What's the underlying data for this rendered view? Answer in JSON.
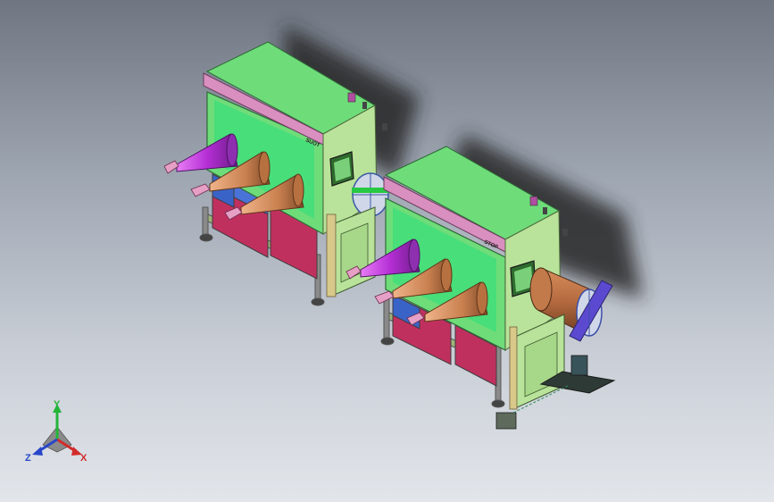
{
  "viewport": {
    "axes": {
      "x_label": "X",
      "y_label": "Y",
      "z_label": "Z"
    }
  },
  "model": {
    "left_unit_plate": "SUOT",
    "right_unit_plate": "STOP"
  },
  "colors": {
    "body_green": "#6fdc7a",
    "side_green": "#b9e39a",
    "top_pink": "#d98fc0",
    "glove_magenta": "#c24be0",
    "glove_copper": "#d8925f",
    "lower_panel_magenta": "#c0305f",
    "lower_panel_blue": "#3a63c7",
    "shadow": "#2b2b2b"
  }
}
